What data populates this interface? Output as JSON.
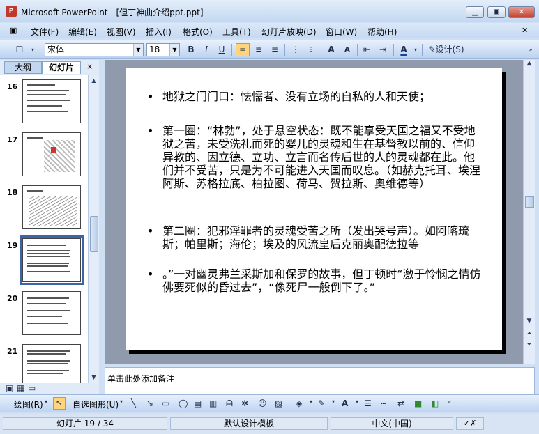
{
  "window": {
    "app_icon_text": "P",
    "title": "Microsoft PowerPoint - [但丁神曲介绍ppt.ppt]",
    "minimize": "▁",
    "restore": "▣",
    "close": "✕"
  },
  "menu": {
    "items": [
      "文件(F)",
      "编辑(E)",
      "视图(V)",
      "插入(I)",
      "格式(O)",
      "工具(T)",
      "幻灯片放映(D)",
      "窗口(W)",
      "帮助(H)"
    ]
  },
  "toolbar": {
    "font_name": "宋体",
    "font_size": "18",
    "bold": "B",
    "italic": "I",
    "underline": "U",
    "design_label": "设计(S)"
  },
  "left_panel": {
    "tab_outline": "大纲",
    "tab_slides": "幻灯片",
    "close": "×",
    "slide_numbers": [
      "16",
      "17",
      "18",
      "19",
      "20",
      "21"
    ],
    "selected_slide": "19"
  },
  "slide": {
    "bullets": [
      "地狱之门门口：怯懦者、没有立场的自私的人和天使；",
      "第一圈：“林勃”，处于悬空状态：既不能享受天国之福又不受地狱之苦，未受洗礼而死的婴儿的灵魂和生在基督教以前的、信仰异教的、因立德、立功、立言而名传后世的人的灵魂都在此。他们并不受苦，只是为不可能进入天国而叹息。（如赫克托耳、埃涅阿斯、苏格拉底、柏拉图、荷马、贺拉斯、奥维德等）",
      "第二圈：犯邪淫罪者的灵魂受苦之所（发出哭号声）。如阿喀琉斯；帕里斯；海伦；埃及的风流皇后克丽奥配德拉等",
      "。”一对幽灵弗兰采斯加和保罗的故事，但丁顿时“激于怜悯之情仿佛要死似的昏过去”，“像死尸一般倒下了。”"
    ]
  },
  "notes": {
    "placeholder": "单击此处添加备注"
  },
  "drawing_toolbar": {
    "draw_label": "绘图(R)",
    "autoshapes_label": "自选图形(U)"
  },
  "status": {
    "slide_info": "幻灯片 19 / 34",
    "template": "默认设计模板",
    "language": "中文(中国)"
  }
}
